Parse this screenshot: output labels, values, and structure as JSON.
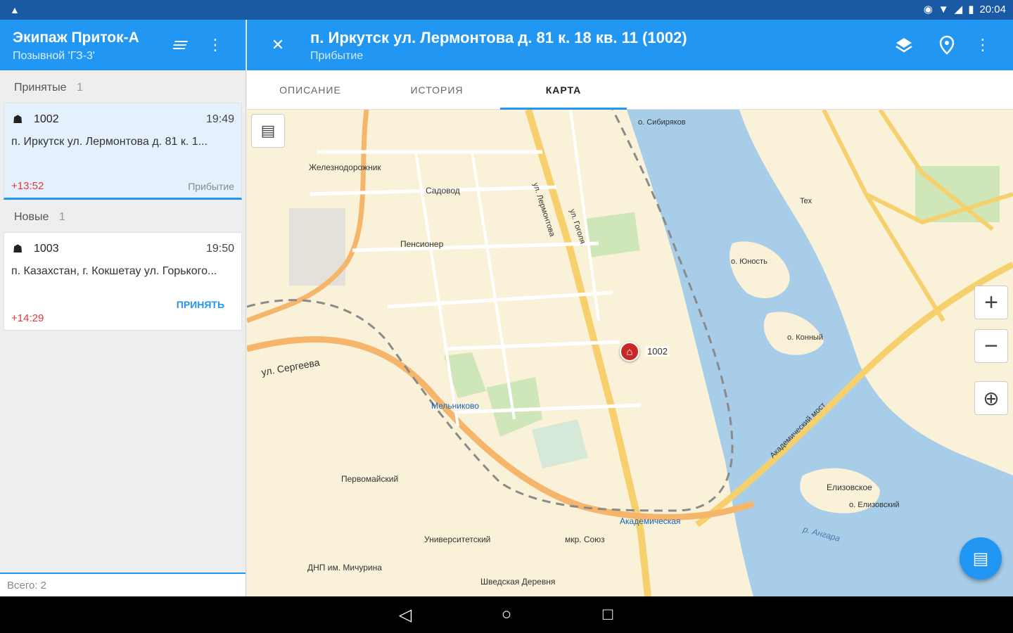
{
  "status_bar": {
    "time": "20:04",
    "left_icon": "android-icon",
    "location_icon": "location-icon",
    "wifi_icon": "wifi-icon",
    "signal_icon": "signal-icon",
    "battery_icon": "battery-icon"
  },
  "left": {
    "title": "Экипаж Приток-А",
    "subtitle": "Позывной 'ГЗ-3'",
    "sections": [
      {
        "label": "Принятые",
        "count": "1",
        "cards": [
          {
            "number": "1002",
            "time": "19:49",
            "address": "п. Иркутск ул. Лермонтова д. 81 к. 1...",
            "delta": "+13:52",
            "status": "Прибытие",
            "action": ""
          }
        ]
      },
      {
        "label": "Новые",
        "count": "1",
        "cards": [
          {
            "number": "1003",
            "time": "19:50",
            "address": "п. Казахстан, г. Кокшетау ул. Горького...",
            "delta": "+14:29",
            "status": "",
            "action": "ПРИНЯТЬ"
          }
        ]
      }
    ],
    "footer": "Всего: 2"
  },
  "right": {
    "title": "п. Иркутск ул. Лермонтова д. 81 к. 18 кв. 11 (1002)",
    "subtitle": "Прибытие",
    "tabs": [
      "ОПИСАНИЕ",
      "ИСТОРИЯ",
      "КАРТА"
    ],
    "active_tab": "КАРТА"
  },
  "map": {
    "marker_label": "1002",
    "labels": [
      "Железнодорожник",
      "Садовод",
      "Пенсионер",
      "ул. Сергеева",
      "Мельниково",
      "Первомайский",
      "Университетский",
      "мкр. Союз",
      "Академическая",
      "ДНП им. Мичурина",
      "Шведская Деревня",
      "Елизовское",
      "о. Елизовский",
      "о. Юность",
      "о. Конный",
      "о. Сибиряков",
      "р. Ангара",
      "Академический мост",
      "ул. Лермонтова",
      "ул. Гоголя",
      "Tex"
    ]
  },
  "colors": {
    "primary": "#2196f3",
    "status_bar": "#1a5aa5",
    "accent_red": "#e53935",
    "water": "#a8cde8",
    "road": "#f7d06e",
    "park": "#cfe6b8"
  }
}
